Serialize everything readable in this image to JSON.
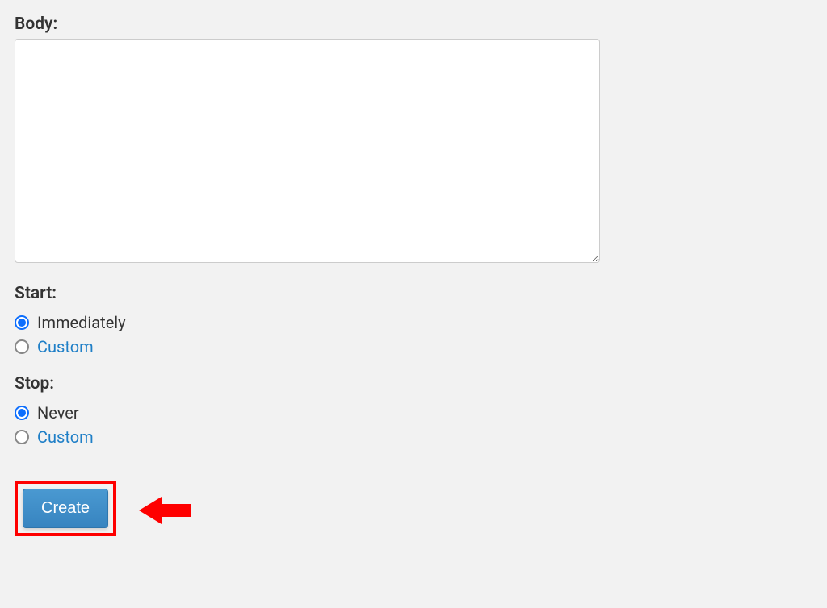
{
  "body": {
    "label": "Body:",
    "value": ""
  },
  "start": {
    "label": "Start:",
    "options": {
      "immediately": "Immediately",
      "custom": "Custom"
    },
    "selected": "immediately"
  },
  "stop": {
    "label": "Stop:",
    "options": {
      "never": "Never",
      "custom": "Custom"
    },
    "selected": "never"
  },
  "actions": {
    "create": "Create"
  },
  "annotation": {
    "highlight_color": "#fe0000",
    "arrow_color": "#fe0000"
  }
}
